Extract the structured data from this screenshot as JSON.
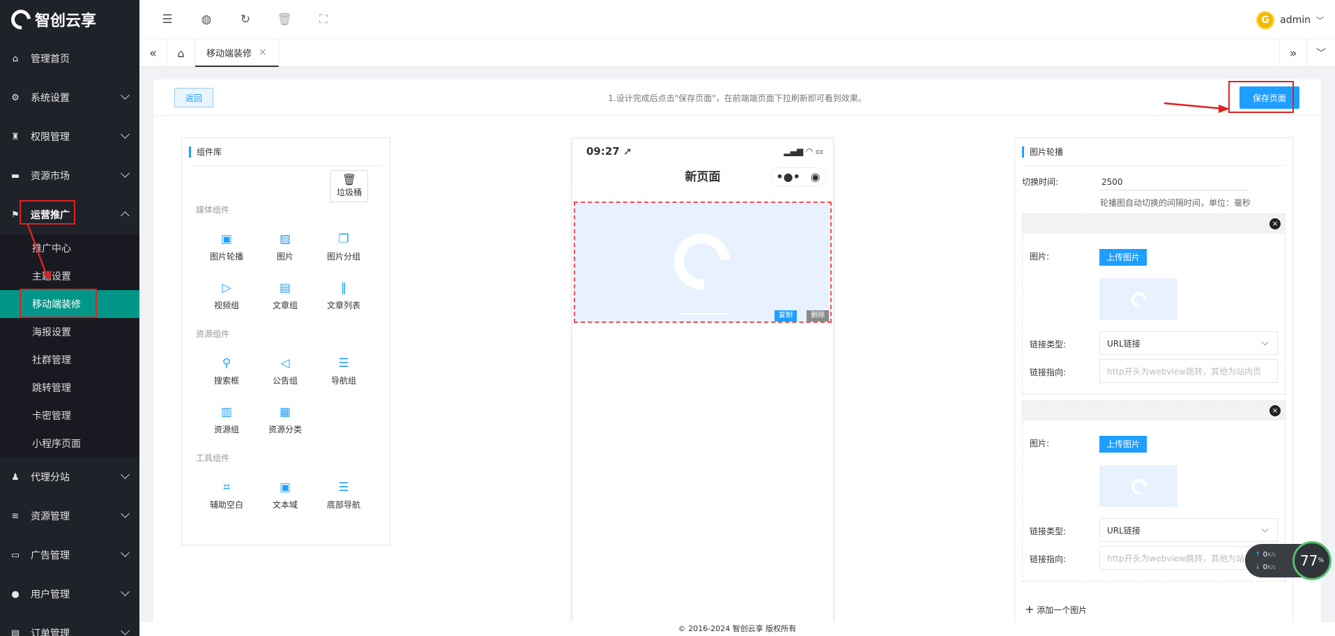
{
  "brand": {
    "name": "智创云享"
  },
  "sidebar": {
    "items": [
      {
        "label": "管理首页",
        "icon": "home-icon"
      },
      {
        "label": "系统设置",
        "icon": "gear-icon"
      },
      {
        "label": "权限管理",
        "icon": "users-icon"
      },
      {
        "label": "资源市场",
        "icon": "store-icon"
      },
      {
        "label": "运营推广",
        "icon": "flag-icon"
      },
      {
        "label": "代理分站",
        "icon": "user-group-icon"
      },
      {
        "label": "资源管理",
        "icon": "layers-icon"
      },
      {
        "label": "广告管理",
        "icon": "ad-icon"
      },
      {
        "label": "用户管理",
        "icon": "user-icon"
      },
      {
        "label": "订单管理",
        "icon": "order-icon"
      }
    ],
    "sub_items": [
      "推广中心",
      "主题设置",
      "移动端装修",
      "海报设置",
      "社群管理",
      "跳转管理",
      "卡密管理",
      "小程序页面"
    ]
  },
  "user": {
    "name": "admin",
    "avatar_letter": "G"
  },
  "tabs": {
    "active": "移动端装修"
  },
  "actionbar": {
    "back_label": "返回",
    "tip": "1.设计完成后点击\"保存页面\"，在前端端页面下拉刷新即可看到效果。",
    "save_label": "保存页面"
  },
  "library": {
    "title": "组件库",
    "trash_label": "垃圾桶",
    "sections": [
      {
        "title": "媒体组件",
        "items": [
          "图片轮播",
          "图片",
          "图片分组",
          "视频组",
          "文章组",
          "文章列表"
        ]
      },
      {
        "title": "资源组件",
        "items": [
          "搜索框",
          "公告组",
          "导航组",
          "资源组",
          "资源分类"
        ]
      },
      {
        "title": "工具组件",
        "items": [
          "辅助空白",
          "文本域",
          "底部导航"
        ]
      }
    ]
  },
  "phone": {
    "time": "09:27",
    "page_title": "新页面",
    "copy_label": "复制",
    "delete_label": "删除"
  },
  "settings": {
    "title": "图片轮播",
    "interval_label": "切换时间:",
    "interval_value": "2500",
    "interval_hint": "轮播图自动切换的间隔时间，单位：毫秒",
    "image_label": "图片:",
    "upload_label": "上传图片",
    "link_type_label": "链接类型:",
    "link_type_value": "URL链接",
    "link_target_label": "链接指向:",
    "link_target_placeholder": "http开头为webview跳转，其他为站内页",
    "link_target_placeholder_2": "http开头为webview跳转，其他为站内页",
    "add_label": "添加一个图片"
  },
  "footer": {
    "text": "© 2016-2024 智创云享 版权所有"
  },
  "network": {
    "up": "0",
    "down": "0",
    "unit": "K/s",
    "percent": "77"
  }
}
